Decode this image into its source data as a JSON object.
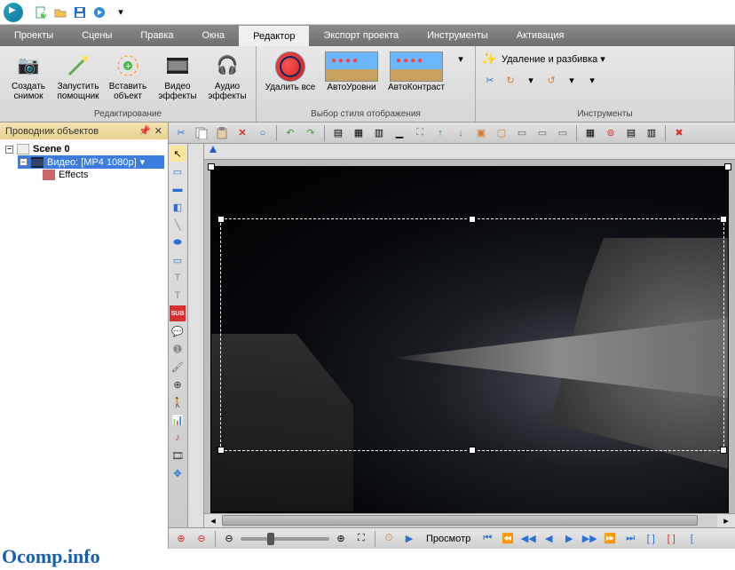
{
  "qat": {
    "items": [
      "new",
      "open",
      "save",
      "play"
    ]
  },
  "menu": {
    "items": [
      {
        "id": "projects",
        "label": "Проекты"
      },
      {
        "id": "scenes",
        "label": "Сцены"
      },
      {
        "id": "edit",
        "label": "Правка"
      },
      {
        "id": "windows",
        "label": "Окна"
      },
      {
        "id": "editor",
        "label": "Редактор",
        "active": true
      },
      {
        "id": "export",
        "label": "Экспорт проекта"
      },
      {
        "id": "tools",
        "label": "Инструменты"
      },
      {
        "id": "activation",
        "label": "Активация"
      }
    ]
  },
  "ribbon": {
    "groups": [
      {
        "id": "editing",
        "title": "Редактирование",
        "buttons": [
          {
            "id": "snapshot",
            "label": "Создать\nснимок"
          },
          {
            "id": "start-helper",
            "label": "Запустить\nпомощник"
          },
          {
            "id": "insert-object",
            "label": "Вставить\nобъект"
          },
          {
            "id": "video-fx",
            "label": "Видео\nэффекты"
          },
          {
            "id": "audio-fx",
            "label": "Аудио\nэффекты"
          }
        ]
      },
      {
        "id": "display-style",
        "title": "Выбор стиля отображения",
        "buttons": [
          {
            "id": "delete-all",
            "label": "Удалить все"
          },
          {
            "id": "auto-levels",
            "label": "АвтоУровни"
          },
          {
            "id": "auto-contrast",
            "label": "АвтоКонтраст"
          }
        ]
      },
      {
        "id": "instruments",
        "title": "Инструменты",
        "header": "Удаление и разбивка"
      }
    ]
  },
  "explorer": {
    "title": "Проводник объектов",
    "scene": "Scene 0",
    "video": "Видео: [MP4 1080p]",
    "effects": "Effects"
  },
  "bottombar": {
    "preview": "Просмотр"
  },
  "watermark": "Ocomp.info"
}
